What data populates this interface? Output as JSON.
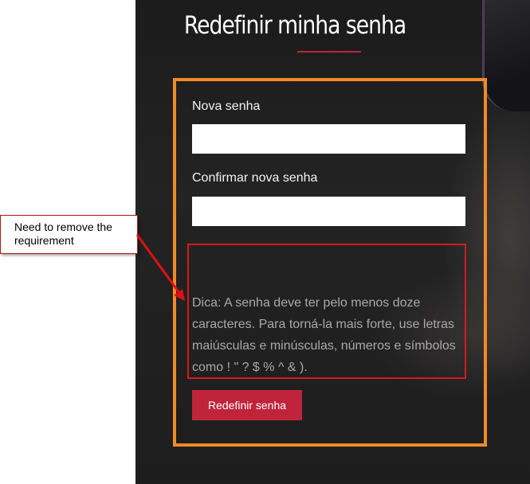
{
  "page": {
    "title": "Redefinir minha senha"
  },
  "form": {
    "new_password_label": "Nova senha",
    "confirm_password_label": "Confirmar nova senha",
    "new_password_value": "",
    "confirm_password_value": "",
    "hint": "Dica: A senha deve ter pelo menos doze caracteres. Para torná-la mais forte, use letras maiúsculas e minúsculas, números e símbolos como ! \" ? $ % ^ & ).",
    "submit_label": "Redefinir senha"
  },
  "annotation": {
    "callout_text": "Need to remove the requirement"
  },
  "colors": {
    "accent": "#c0243a",
    "highlight_box": "#f08a24",
    "annotation_red": "#d61a1a",
    "background_dark": "#1d1d1d"
  }
}
